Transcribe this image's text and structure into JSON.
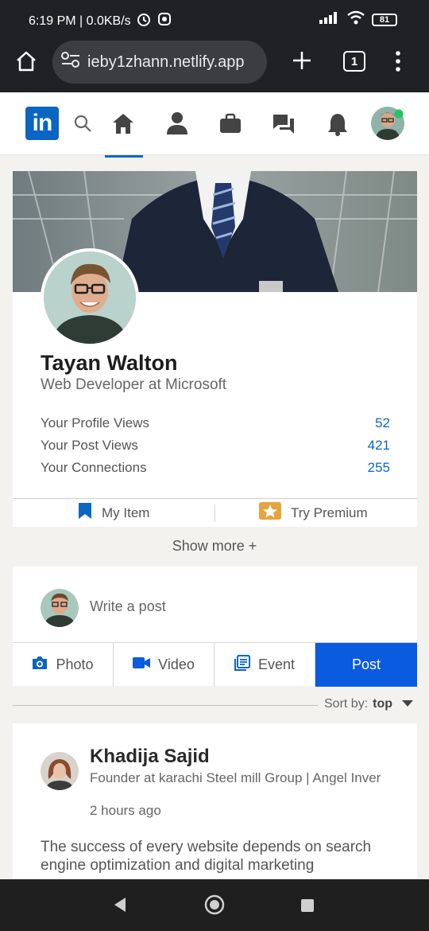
{
  "status": {
    "time_speed": "6:19 PM | 0.0KB/s",
    "battery": "81"
  },
  "browser": {
    "url": "ieby1zhann.netlify.app",
    "tab_count": "1"
  },
  "nav": {
    "logo": "in"
  },
  "profile": {
    "name": "Tayan Walton",
    "headline": "Web Developer at Microsoft",
    "stats": [
      {
        "label": "Your Profile Views",
        "value": "52"
      },
      {
        "label": "Your Post Views",
        "value": "421"
      },
      {
        "label": "Your Connections",
        "value": "255"
      }
    ],
    "my_item": "My Item",
    "try_premium": "Try Premium"
  },
  "show_more": "Show more +",
  "composer": {
    "placeholder": "Write a post",
    "photo": "Photo",
    "video": "Video",
    "event": "Event",
    "post": "Post"
  },
  "sort": {
    "label": "Sort by:",
    "value": "top"
  },
  "feed_post": {
    "author": "Khadija Sajid",
    "subtitle": "Founder at karachi Steel mill Group | Angel Inver",
    "time": "2 hours ago",
    "text": "The success of every website depends on search engine optimization and digital marketing"
  },
  "colors": {
    "brand": "#0a66c2",
    "post_button": "#0a5bdf",
    "online": "#22c55e"
  }
}
